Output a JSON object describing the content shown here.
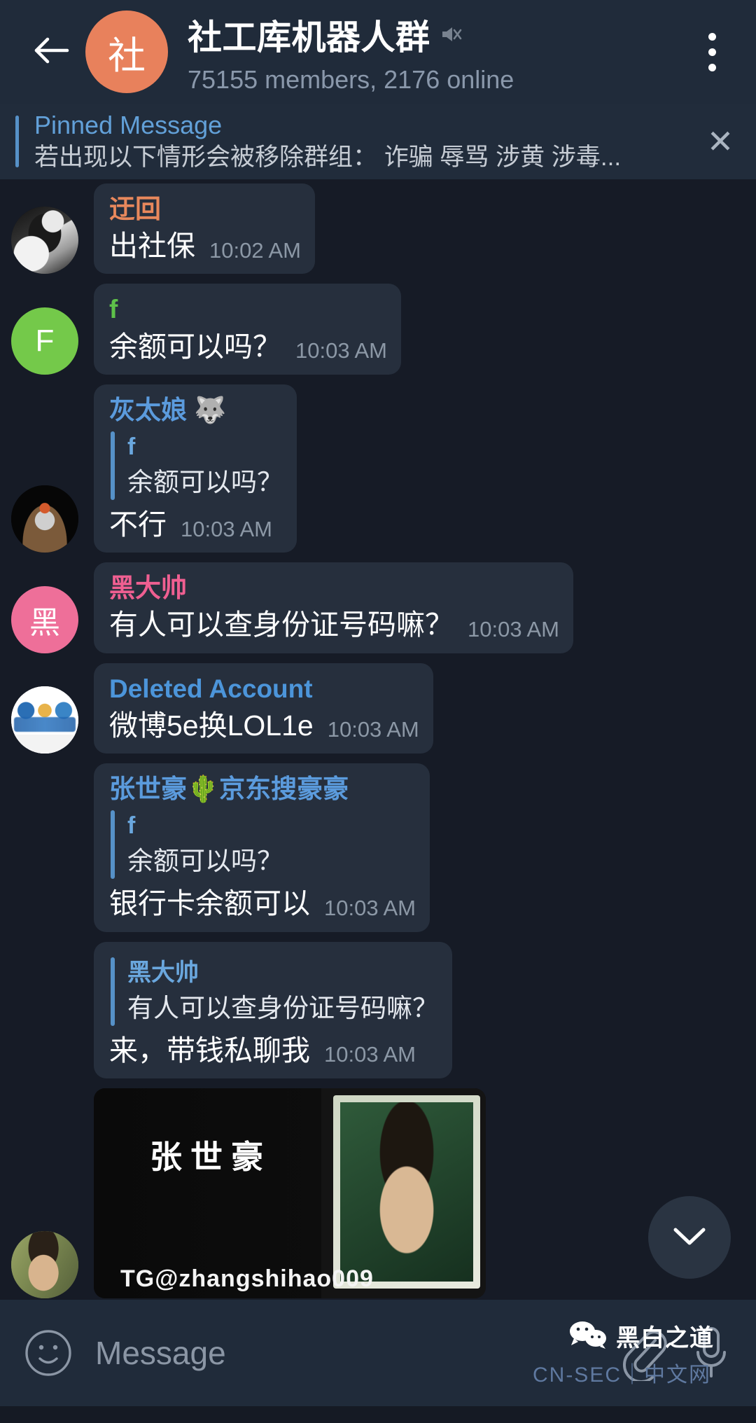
{
  "header": {
    "back_icon": "arrow-left-icon",
    "avatar_letter": "社",
    "avatar_color": "#e8815c",
    "title": "社工库机器人群",
    "mute_icon": "mute-icon",
    "subtitle": "75155 members, 2176 online",
    "menu_icon": "more-vertical-icon"
  },
  "pinned": {
    "label": "Pinned Message",
    "text": "若出现以下情形会被移除群组： 诈骗 辱骂 涉黄 涉毒...",
    "close_icon": "close-icon",
    "accent": "#5691c8"
  },
  "messages": [
    {
      "avatar_kind": "photo1",
      "avatar_letter": "",
      "sender": "迂回",
      "sender_color": "#e8885c",
      "text": "出社保",
      "time": "10:02 AM",
      "reply": null
    },
    {
      "avatar_kind": "letter",
      "avatar_letter": "F",
      "avatar_color": "#74c94a",
      "sender": "f",
      "sender_color": "#5ec24a",
      "text": "余额可以吗？",
      "time": "10:03 AM",
      "reply": null
    },
    {
      "avatar_kind": "photo2",
      "avatar_letter": "",
      "sender": "灰太娘 🐺",
      "sender_color": "#5b9bdd",
      "text": "不行",
      "time": "10:03 AM",
      "reply": {
        "name": "f",
        "text": "余额可以吗？"
      }
    },
    {
      "avatar_kind": "letter",
      "avatar_letter": "黑",
      "avatar_color": "#ee6f99",
      "sender": "黑大帅",
      "sender_color": "#ef5f91",
      "text": "有人可以查身份证号码嘛？",
      "time": "10:03 AM",
      "reply": null
    },
    {
      "avatar_kind": "photo3",
      "avatar_letter": "",
      "sender": "Deleted Account",
      "sender_color": "#4c95da",
      "text": "微博5e换LOL1e",
      "time": "10:03 AM",
      "reply": null
    },
    {
      "avatar_kind": "none",
      "avatar_letter": "",
      "sender": "张世豪🌵京东搜豪豪",
      "sender_color": "#5b9bdd",
      "text": "银行卡余额可以",
      "time": "10:03 AM",
      "reply": {
        "name": "f",
        "text": "余额可以吗？"
      }
    },
    {
      "avatar_kind": "none",
      "avatar_letter": "",
      "sender": "",
      "sender_color": "#5b9bdd",
      "text": "来，带钱私聊我",
      "time": "10:03 AM",
      "reply": {
        "name": "黑大帅",
        "text": "有人可以查身份证号码嘛？"
      }
    }
  ],
  "photo_message": {
    "avatar_kind": "photo4",
    "caption_name": "张世豪",
    "caption_handle": "TG@zhangshihao009"
  },
  "scroll_button": {
    "icon": "chevron-down-icon"
  },
  "input_bar": {
    "emoji_icon": "smiley-icon",
    "placeholder": "Message",
    "attach_icon": "paperclip-icon",
    "mic_icon": "microphone-icon"
  },
  "watermarks": {
    "wechat": "黑白之道",
    "cnsec": "CN-SEC｜中文网"
  }
}
